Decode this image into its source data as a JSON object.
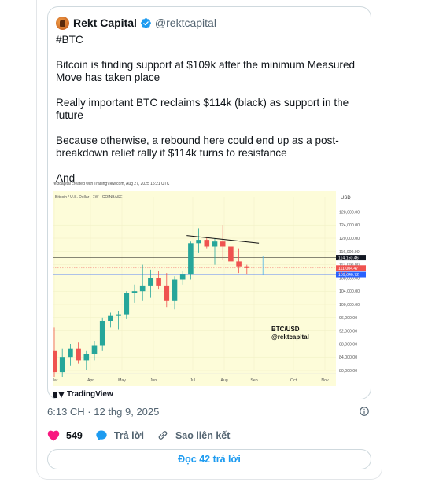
{
  "quote": {
    "author_name": "Rekt Capital",
    "author_handle": "@rektcapital",
    "paragraphs": [
      "#BTC",
      "Bitcoin is finding support at $109k after the minimum Measured Move has taken place",
      "Really important BTC reclaims $114k (black) as support in the future",
      "Because otherwise, a rebound here could end up as a post-breakdown relief rally if $114k turns to resistance",
      "And"
    ]
  },
  "chart": {
    "meta": "rektcapital created with TradingView.com, Aug 27, 2025 15:21 UTC",
    "symbol": "Bitcoin / U.S. Dollar · 1W · COINBASE",
    "currency": "USD",
    "watermark_line1": "BTC/USD",
    "watermark_line2": "@rektcapital",
    "brand": "TradingView",
    "price_tags": [
      "114,150.46",
      "111,004.47",
      "4d 01",
      "109,040.72"
    ]
  },
  "chart_data": {
    "type": "candlestick",
    "title": "Bitcoin / U.S. Dollar · 1W · COINBASE",
    "x_tick_labels": [
      "Mar",
      "Apr",
      "May",
      "Jun",
      "Jul",
      "Aug",
      "Sep",
      "Oct",
      "Nov"
    ],
    "y_tick_labels": [
      "128,000.00",
      "124,000.00",
      "120,000.00",
      "116,000.00",
      "112,000.00",
      "108,000.00",
      "104,000.00",
      "100,000.00",
      "96,000.00",
      "92,000.00",
      "88,000.00",
      "84,000.00",
      "80,000.00"
    ],
    "ylim": [
      80000,
      130000
    ],
    "candles": [
      {
        "o": 86000,
        "h": 93000,
        "l": 78000,
        "c": 79500
      },
      {
        "o": 79500,
        "h": 86500,
        "l": 78000,
        "c": 84000
      },
      {
        "o": 84000,
        "h": 88000,
        "l": 81500,
        "c": 86500
      },
      {
        "o": 86500,
        "h": 88500,
        "l": 82000,
        "c": 83000
      },
      {
        "o": 83000,
        "h": 86000,
        "l": 80000,
        "c": 85000
      },
      {
        "o": 85000,
        "h": 89000,
        "l": 83000,
        "c": 87500
      },
      {
        "o": 87500,
        "h": 96000,
        "l": 86000,
        "c": 95000
      },
      {
        "o": 95000,
        "h": 97500,
        "l": 93000,
        "c": 96500
      },
      {
        "o": 96500,
        "h": 98000,
        "l": 92500,
        "c": 97000
      },
      {
        "o": 97000,
        "h": 104000,
        "l": 95500,
        "c": 103500
      },
      {
        "o": 103500,
        "h": 106000,
        "l": 100500,
        "c": 104000
      },
      {
        "o": 104000,
        "h": 112000,
        "l": 101000,
        "c": 105500
      },
      {
        "o": 105500,
        "h": 110500,
        "l": 102000,
        "c": 108000
      },
      {
        "o": 108000,
        "h": 110000,
        "l": 104500,
        "c": 105500
      },
      {
        "o": 105500,
        "h": 109500,
        "l": 99000,
        "c": 101000
      },
      {
        "o": 101000,
        "h": 108500,
        "l": 98500,
        "c": 107500
      },
      {
        "o": 107500,
        "h": 110000,
        "l": 106000,
        "c": 109000
      },
      {
        "o": 109000,
        "h": 119000,
        "l": 107500,
        "c": 118500
      },
      {
        "o": 118500,
        "h": 123000,
        "l": 115500,
        "c": 119500
      },
      {
        "o": 119500,
        "h": 120500,
        "l": 117000,
        "c": 117500
      },
      {
        "o": 117500,
        "h": 120000,
        "l": 112000,
        "c": 119000
      },
      {
        "o": 119000,
        "h": 124000,
        "l": 113500,
        "c": 117500
      },
      {
        "o": 117500,
        "h": 118500,
        "l": 111500,
        "c": 113000
      },
      {
        "o": 113000,
        "h": 117000,
        "l": 109500,
        "c": 111500
      },
      {
        "o": 111500,
        "h": 112000,
        "l": 109000,
        "c": 111000
      }
    ],
    "horizontal_lines": [
      114150.46,
      109040.72
    ],
    "annotations": [
      "BTC/USD",
      "@rektcapital"
    ]
  },
  "meta": {
    "timestamp": "6:13 CH · 12 thg 9, 2025"
  },
  "actions": {
    "likes": "549",
    "reply_label": "Trả lời",
    "share_label": "Sao liên kết"
  },
  "footer": {
    "read_replies_label": "Đọc 42 trả lời"
  },
  "colors": {
    "up": "#26a69a",
    "down": "#ef5350",
    "accent": "#1d9bf0",
    "like": "#f91880",
    "plot_bg": "#fdfcd9"
  }
}
